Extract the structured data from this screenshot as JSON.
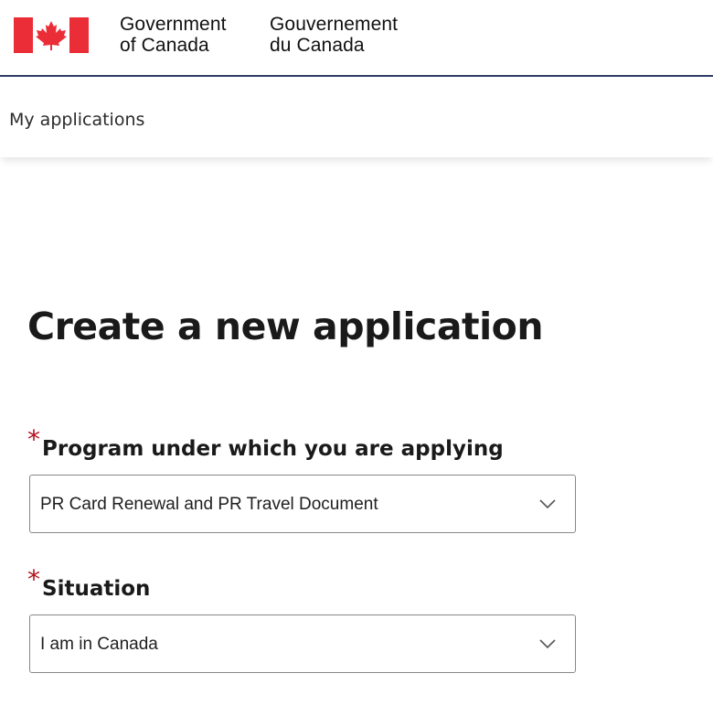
{
  "header": {
    "flag_icon": "canada-flag-icon",
    "signature_en_line1": "Government",
    "signature_en_line2": "of Canada",
    "signature_fr_line1": "Gouvernement",
    "signature_fr_line2": "du Canada",
    "colors": {
      "flag_red": "#eb2d37",
      "rule": "#2f3a66"
    }
  },
  "nav": {
    "my_applications_label": "My applications"
  },
  "main": {
    "title": "Create a new application",
    "required_marker": "*",
    "program_field": {
      "label": "Program under which you are applying",
      "selected_value": "PR Card Renewal and PR Travel Document",
      "icon": "chevron-down-icon"
    },
    "situation_field": {
      "label": "Situation",
      "selected_value": "I am in Canada",
      "icon": "chevron-down-icon"
    },
    "colors": {
      "required": "#b3121f"
    }
  }
}
